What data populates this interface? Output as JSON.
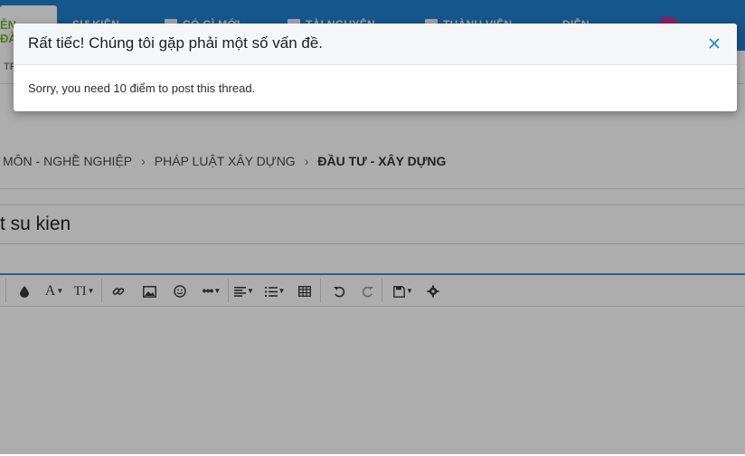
{
  "nav": {
    "home_label": "ỄN ĐÀN",
    "items": [
      "SỰ KIỆN",
      "CÓ GÌ MỚI",
      "TÀI NGUYÊN",
      "THÀNH VIÊN",
      "DIỄN"
    ],
    "sub_item": "TR"
  },
  "breadcrumb": {
    "items": [
      "MÔN - NGHỀ NGHIỆP",
      "PHÁP LUẬT XÂY DỰNG"
    ],
    "separator": "›",
    "current": "ĐẦU TƯ - XÂY DỰNG"
  },
  "thread": {
    "title_value": "t su kien"
  },
  "toolbar": {
    "icons": [
      "color-icon",
      "font-family-icon",
      "font-size-icon",
      "link-icon",
      "image-icon",
      "smilie-icon",
      "more-icon",
      "align-icon",
      "list-icon",
      "table-icon",
      "undo-icon",
      "redo-icon",
      "save-draft-icon",
      "settings-icon"
    ],
    "font_glyph": "A",
    "size_glyph": "TI"
  },
  "modal": {
    "title": "Rất tiếc! Chúng tôi gặp phải một số vấn đề.",
    "message": "Sorry, you need 10 điểm to post this thread."
  },
  "colors": {
    "nav_bg": "#1f7fd0",
    "accent": "#3b8ed8",
    "close": "#2a86d4"
  }
}
